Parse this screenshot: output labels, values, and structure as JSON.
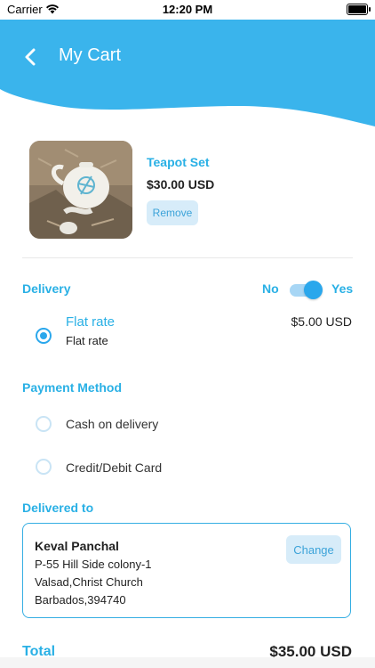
{
  "status_bar": {
    "carrier": "Carrier",
    "time": "12:20 PM"
  },
  "header": {
    "title": "My Cart",
    "background_color": "#3ab4ec"
  },
  "cart_item": {
    "name": "Teapot Set",
    "price": "$30.00 USD",
    "remove_label": "Remove"
  },
  "delivery": {
    "label": "Delivery",
    "toggle_no": "No",
    "toggle_yes": "Yes",
    "toggle_on": true,
    "option_title": "Flat rate",
    "option_subtitle": "Flat rate",
    "option_price": "$5.00 USD",
    "option_selected": true
  },
  "payment": {
    "label": "Payment Method",
    "options": [
      {
        "label": "Cash on delivery",
        "selected": false
      },
      {
        "label": "Credit/Debit Card",
        "selected": false
      }
    ]
  },
  "delivered_to": {
    "label": "Delivered to",
    "name": "Keval Panchal",
    "lines": [
      "P-55 Hill Side colony-1",
      "Valsad,Christ Church",
      "Barbados,394740"
    ],
    "change_label": "Change"
  },
  "total": {
    "label": "Total",
    "value": "$35.00 USD"
  },
  "colors": {
    "accent": "#29b0e5",
    "button_bg": "#d7ecf9",
    "toggle": "#2aa7ec"
  }
}
